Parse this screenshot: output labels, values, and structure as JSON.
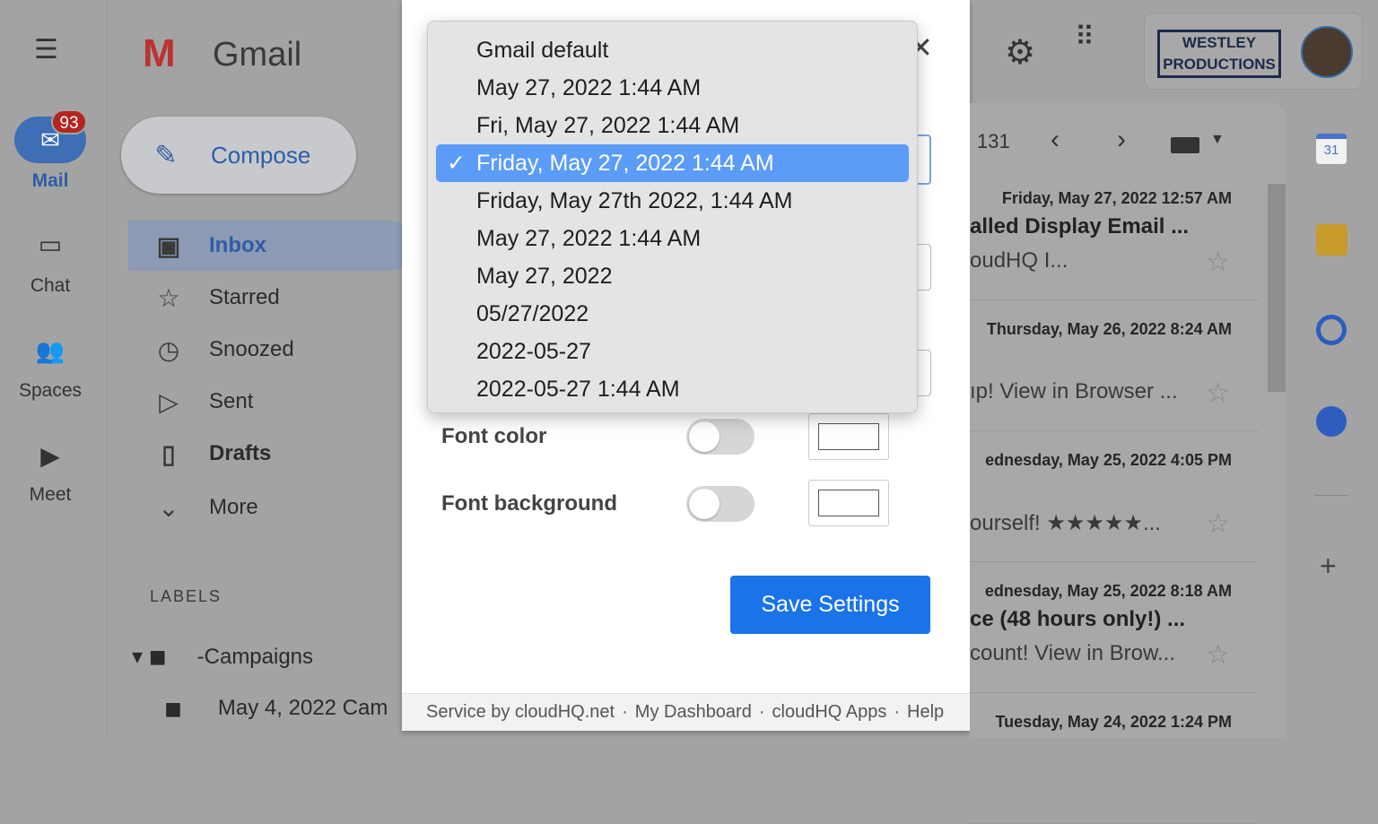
{
  "rail": {
    "mail_label": "Mail",
    "mail_badge": "93",
    "chat_label": "Chat",
    "spaces_label": "Spaces",
    "meet_label": "Meet"
  },
  "header": {
    "app_name": "Gmail",
    "brand": "WESTLEY PRODUCTIONS"
  },
  "nav": {
    "compose": "Compose",
    "items": [
      {
        "label": "Inbox",
        "icon": "inbox-icon"
      },
      {
        "label": "Starred",
        "icon": "star-icon"
      },
      {
        "label": "Snoozed",
        "icon": "clock-icon"
      },
      {
        "label": "Sent",
        "icon": "send-icon"
      },
      {
        "label": "Drafts",
        "icon": "draft-icon"
      },
      {
        "label": "More",
        "icon": "chevron-down-icon"
      }
    ],
    "labels_heading": "LABELS",
    "labels": [
      {
        "label": "-Campaigns"
      },
      {
        "label": "May 4, 2022 Cam"
      }
    ]
  },
  "dropdown": {
    "selected_index": 3,
    "options": [
      "Gmail default",
      "May 27, 2022 1:44 AM",
      "Fri, May 27, 2022 1:44 AM",
      "Friday, May 27, 2022 1:44 AM",
      "Friday, May 27th 2022, 1:44 AM",
      "May 27, 2022 1:44 AM",
      "May 27, 2022",
      "05/27/2022",
      "2022-05-27",
      "2022-05-27 1:44 AM"
    ]
  },
  "settings": {
    "font_color_label": "Font color",
    "font_color_on": false,
    "font_bg_label": "Font background",
    "font_bg_on": false,
    "save_label": "Save Settings"
  },
  "footer": {
    "service": "Service by cloudHQ.net",
    "dashboard": "My Dashboard",
    "apps": "cloudHQ Apps",
    "help": "Help",
    "sep": "·"
  },
  "list": {
    "count": "131",
    "emails": [
      {
        "date": "Friday, May 27, 2022 12:57 AM",
        "subject": "alled Display Email ...",
        "snippet": "oudHQ            I..."
      },
      {
        "date": "Thursday, May 26, 2022 8:24 AM",
        "subject": "",
        "snippet": "ıp! View in Browser ..."
      },
      {
        "date": "ednesday, May 25, 2022 4:05 PM",
        "subject": "",
        "snippet": "ourself! ★★★★★..."
      },
      {
        "date": "ednesday, May 25, 2022 8:18 AM",
        "subject": "ce (48 hours only!) ...",
        "snippet": "count! View in Brow..."
      },
      {
        "date": "Tuesday, May 24, 2022 1:24 PM",
        "subject": "",
        "snippet": ""
      }
    ]
  },
  "side": {
    "calendar_day": "31"
  },
  "colors": {
    "accent": "#1a73e8",
    "selected_option": "#5a9cf8"
  }
}
